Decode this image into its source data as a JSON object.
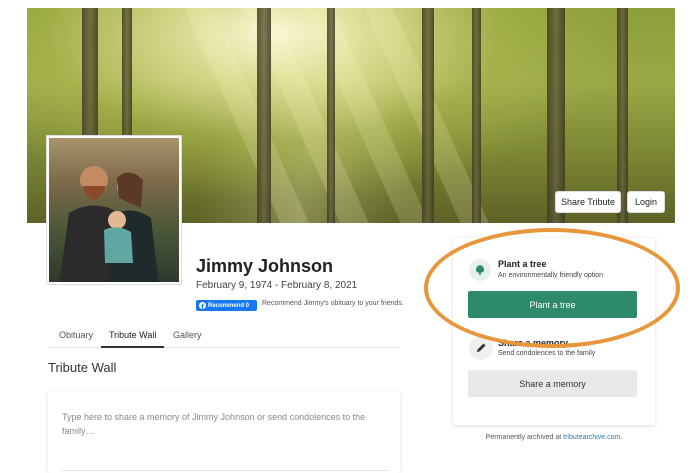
{
  "header": {
    "share_label": "Share Tribute",
    "login_label": "Login"
  },
  "profile": {
    "name": "Jimmy Johnson",
    "dates": "February 9, 1974 - February 8, 2021",
    "recommend_label": "Recommend 0",
    "recommend_text": "Recommend Jimmy's obituary to your friends."
  },
  "tabs": [
    {
      "label": "Obituary"
    },
    {
      "label": "Tribute Wall"
    },
    {
      "label": "Gallery"
    }
  ],
  "section": {
    "title": "Tribute Wall",
    "composer_placeholder": "Type here to share a memory of Jimmy Johnson or send condolences to the family…"
  },
  "sidebar": {
    "plant_title": "Plant a tree",
    "plant_subtitle": "An environmentally friendly option",
    "plant_button": "Plant a tree",
    "memory_title": "Share a memory",
    "memory_subtitle": "Send condolences to the family",
    "memory_button": "Share a memory",
    "archived_prefix": "Permanently archived at ",
    "archived_link": "tributearchive.com",
    "archived_suffix": "."
  },
  "colors": {
    "accent_green": "#2e8b69",
    "facebook_blue": "#1877f2",
    "highlight_orange": "#e8963a"
  },
  "icons": {
    "tree": "tree-icon",
    "pen": "pen-icon"
  }
}
